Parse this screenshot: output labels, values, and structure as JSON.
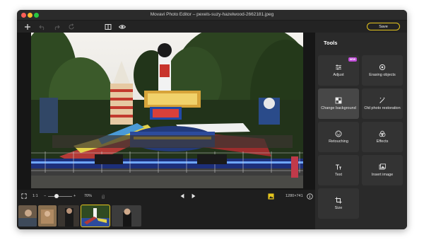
{
  "window": {
    "title": "Movavi Photo Editor – pexels-suzy-hazelwood-2662181.jpeg"
  },
  "toolbar": {
    "save_label": "Save"
  },
  "bottombar": {
    "ratio_label": "1:1",
    "zoom_minus": "−",
    "zoom_plus": "+",
    "zoom_value": "70%",
    "zoom_level": 0.35,
    "dimensions": "1280×741"
  },
  "panel": {
    "title": "Tools",
    "tools": [
      {
        "label": "Adjust",
        "badge": "NEW",
        "icon": "sliders-icon"
      },
      {
        "label": "Erasing objects",
        "icon": "eraser-icon"
      },
      {
        "label": "Change background",
        "icon": "checker-icon"
      },
      {
        "label": "Old photo restoration",
        "icon": "wand-icon"
      },
      {
        "label": "Retouching",
        "icon": "smile-icon"
      },
      {
        "label": "Effects",
        "icon": "circles-icon"
      },
      {
        "label": "Text",
        "icon": "text-icon"
      },
      {
        "label": "Insert image",
        "icon": "image-icon"
      },
      {
        "label": "Size",
        "icon": "crop-icon"
      }
    ]
  },
  "colors": {
    "accent": "#e6c61e",
    "badge": "#c04ad8",
    "panel_bg": "#2a2a2a",
    "tool_bg": "#333333"
  }
}
